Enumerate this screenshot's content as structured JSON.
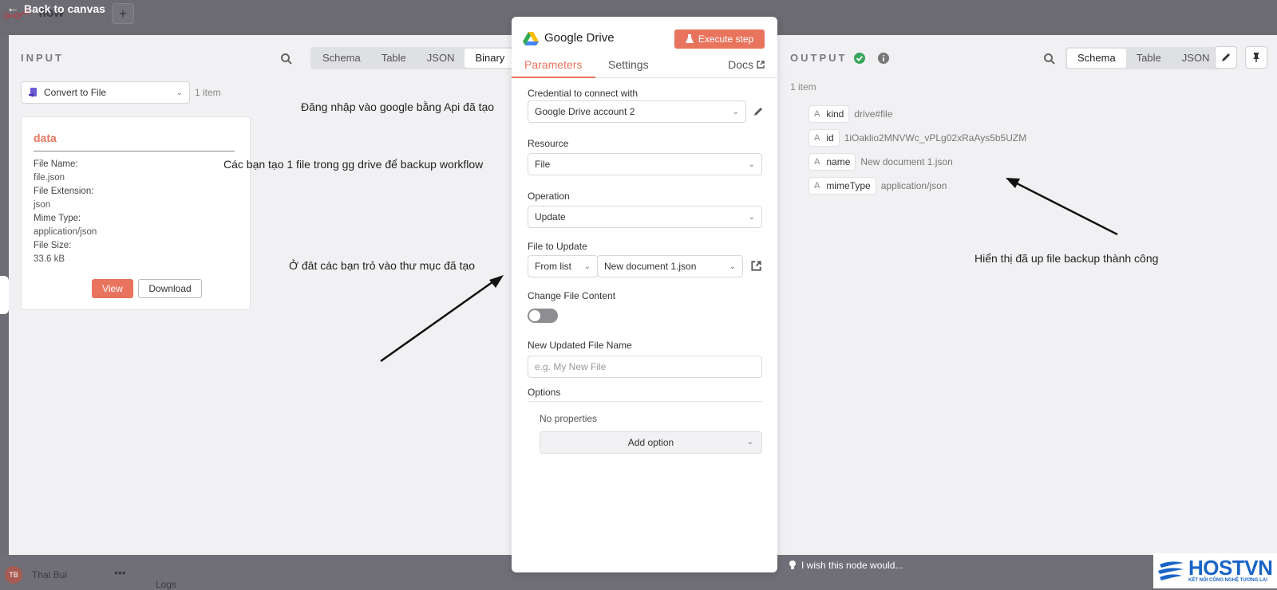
{
  "topbar": {
    "back_label": "Back to canvas",
    "workflow_name": "flow"
  },
  "input": {
    "title": "INPUT",
    "tabs": [
      "Schema",
      "Table",
      "JSON",
      "Binary"
    ],
    "active_tab": "Binary",
    "node_select": "Convert to File",
    "item_count": "1 item",
    "card": {
      "title": "data",
      "fields": [
        {
          "key": "File Name:",
          "value": "file.json"
        },
        {
          "key": "File Extension:",
          "value": "json"
        },
        {
          "key": "Mime Type:",
          "value": "application/json"
        },
        {
          "key": "File Size:",
          "value": "33.6 kB"
        }
      ],
      "view_label": "View",
      "download_label": "Download"
    }
  },
  "annotations": {
    "login": "Đăng nhập vào google bằng Api đã tạo",
    "create_file": "Các bạn tạo 1 file trong gg drive để backup workflow",
    "point_folder": "Ở đât các bạn trỏ vào thư mục đã tạo",
    "success": "Hiển thị đã up file backup thành công"
  },
  "node": {
    "title": "Google Drive",
    "execute_label": "Execute step",
    "tabs": {
      "parameters": "Parameters",
      "settings": "Settings",
      "docs": "Docs"
    },
    "credential_label": "Credential to connect with",
    "credential_value": "Google Drive account 2",
    "resource_label": "Resource",
    "resource_value": "File",
    "operation_label": "Operation",
    "operation_value": "Update",
    "file_label": "File to Update",
    "file_mode": "From list",
    "file_value": "New document 1.json",
    "change_content_label": "Change File Content",
    "change_content_on": false,
    "new_name_label": "New Updated File Name",
    "new_name_placeholder": "e.g. My New File",
    "options_label": "Options",
    "no_properties": "No properties",
    "add_option": "Add option"
  },
  "output": {
    "title": "OUTPUT",
    "tabs": [
      "Schema",
      "Table",
      "JSON"
    ],
    "active_tab": "Schema",
    "item_count": "1 item",
    "schema": [
      {
        "key": "kind",
        "value": "drive#file"
      },
      {
        "key": "id",
        "value": "1iOaklio2MNVWc_vPLg02xRaAys5b5UZM"
      },
      {
        "key": "name",
        "value": "New document 1.json"
      },
      {
        "key": "mimeType",
        "value": "application/json"
      }
    ]
  },
  "bottom": {
    "avatar_initials": "TB",
    "user_name": "Thai Bui",
    "logs_label": "Logs",
    "wish_label": "I wish this node would..."
  },
  "brand": {
    "name": "HOSTVN",
    "tagline": "KẾT NỐI CÔNG NGHỆ TƯƠNG LAI"
  },
  "colors": {
    "accent": "#e8745e",
    "success": "#3ba55c",
    "brand": "#1a64c6"
  }
}
